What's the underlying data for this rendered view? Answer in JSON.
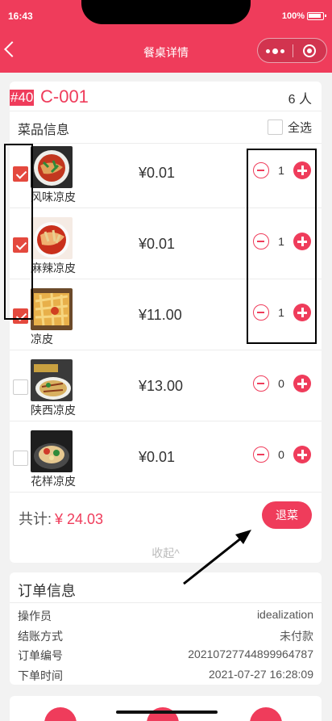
{
  "status_bar": {
    "time": "16:43",
    "battery": "100%"
  },
  "nav": {
    "title": "餐桌详情"
  },
  "table": {
    "number": "#40",
    "code": "C-001",
    "people": "6 人"
  },
  "dishes_section": {
    "title": "菜品信息",
    "select_all": "全选"
  },
  "dishes": [
    {
      "name": "风味凉皮",
      "price": "¥0.01",
      "qty": "1",
      "checked": true
    },
    {
      "name": "麻辣凉皮",
      "price": "¥0.01",
      "qty": "1",
      "checked": true
    },
    {
      "name": "凉皮",
      "price": "¥11.00",
      "qty": "1",
      "checked": true
    },
    {
      "name": "陕西凉皮",
      "price": "¥13.00",
      "qty": "0",
      "checked": false
    },
    {
      "name": "花样凉皮",
      "price": "¥0.01",
      "qty": "0",
      "checked": false
    }
  ],
  "summary": {
    "total_label": "共计:",
    "total_amount": "¥ 24.03",
    "return_button": "退菜",
    "collapse": "收起^"
  },
  "order_info": {
    "title": "订单信息",
    "rows": [
      {
        "label": "操作员",
        "value": "idealization"
      },
      {
        "label": "结账方式",
        "value": "未付款"
      },
      {
        "label": "订单编号",
        "value": "20210727744899964787"
      },
      {
        "label": "下单时间",
        "value": "2021-07-27 16:28:09"
      }
    ]
  },
  "colors": {
    "accent": "#ef3c5b",
    "checkbox": "#e4493e"
  }
}
